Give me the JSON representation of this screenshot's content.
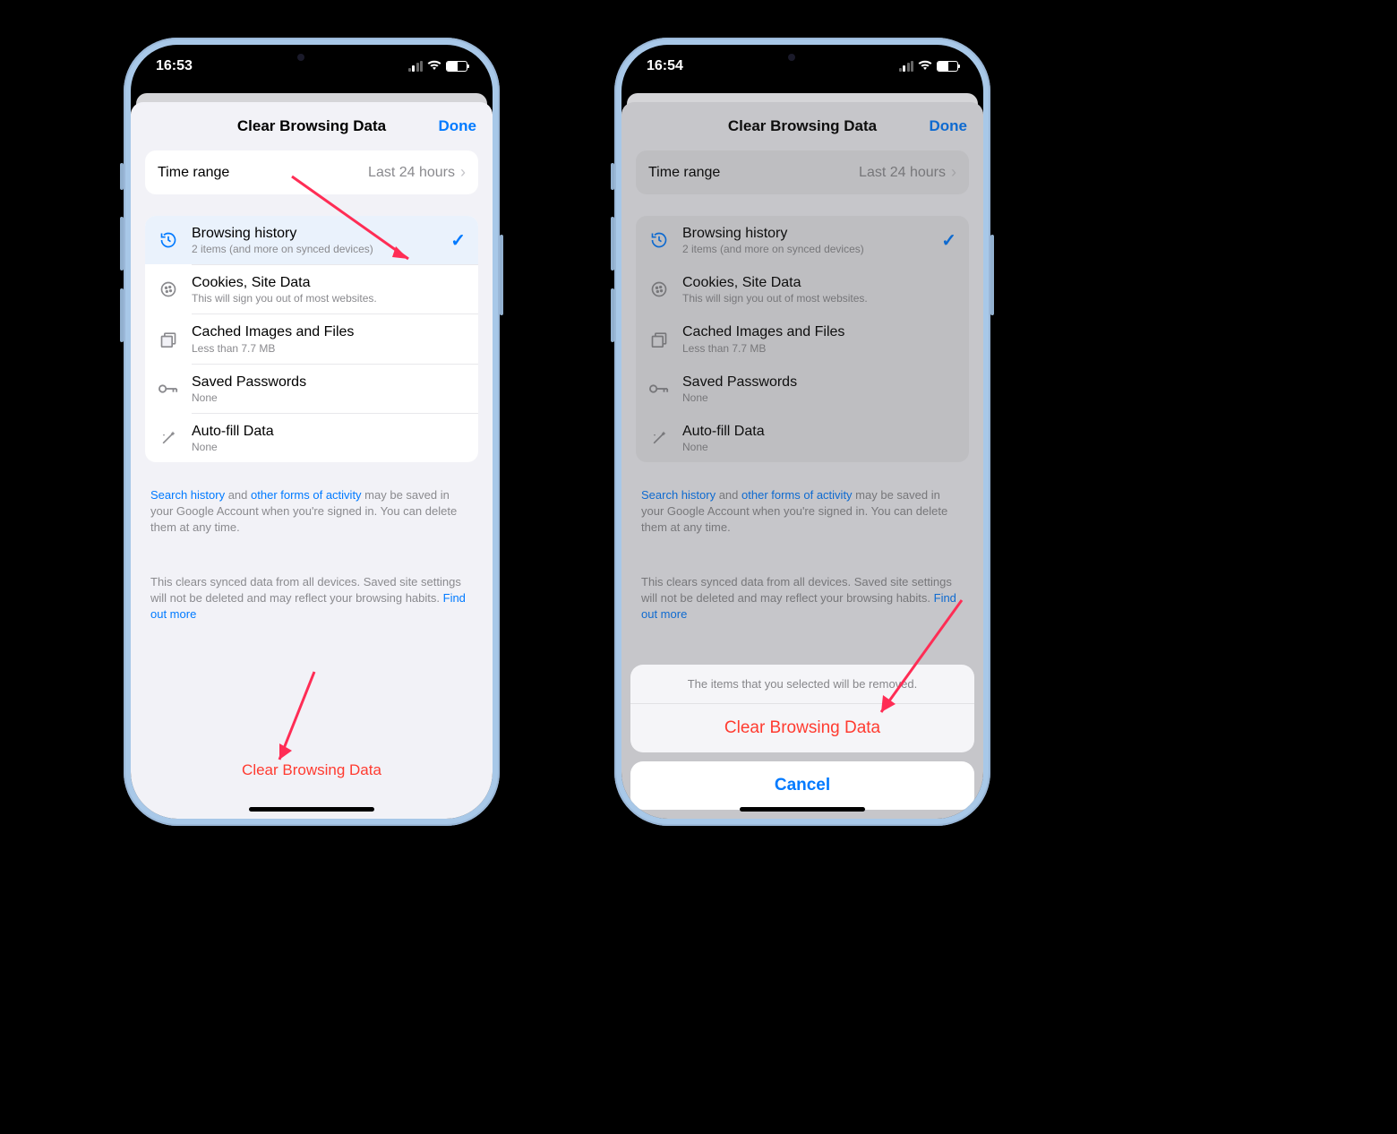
{
  "phone1": {
    "status_time": "16:53",
    "header": {
      "title": "Clear Browsing Data",
      "done": "Done"
    },
    "time_range": {
      "label": "Time range",
      "value": "Last 24 hours"
    },
    "items": [
      {
        "icon": "history-icon",
        "title": "Browsing history",
        "subtitle": "2 items (and more on synced devices)",
        "checked": true
      },
      {
        "icon": "cookie-icon",
        "title": "Cookies, Site Data",
        "subtitle": "This will sign you out of most websites.",
        "checked": false
      },
      {
        "icon": "image-icon",
        "title": "Cached Images and Files",
        "subtitle": "Less than 7.7 MB",
        "checked": false
      },
      {
        "icon": "key-icon",
        "title": "Saved Passwords",
        "subtitle": "None",
        "checked": false
      },
      {
        "icon": "wand-icon",
        "title": "Auto-fill Data",
        "subtitle": "None",
        "checked": false
      }
    ],
    "footer1": {
      "link1": "Search history",
      "mid1": " and ",
      "link2": "other forms of activity",
      "rest": " may be saved in your Google Account when you're signed in. You can delete them at any time."
    },
    "footer2": {
      "text": "This clears synced data from all devices. Saved site settings will not be deleted and may reflect your browsing habits. ",
      "link": "Find out more"
    },
    "clear_button": "Clear Browsing Data"
  },
  "phone2": {
    "status_time": "16:54",
    "header": {
      "title": "Clear Browsing Data",
      "done": "Done"
    },
    "time_range": {
      "label": "Time range",
      "value": "Last 24 hours"
    },
    "items": [
      {
        "icon": "history-icon",
        "title": "Browsing history",
        "subtitle": "2 items (and more on synced devices)",
        "checked": true
      },
      {
        "icon": "cookie-icon",
        "title": "Cookies, Site Data",
        "subtitle": "This will sign you out of most websites.",
        "checked": false
      },
      {
        "icon": "image-icon",
        "title": "Cached Images and Files",
        "subtitle": "Less than 7.7 MB",
        "checked": false
      },
      {
        "icon": "key-icon",
        "title": "Saved Passwords",
        "subtitle": "None",
        "checked": false
      },
      {
        "icon": "wand-icon",
        "title": "Auto-fill Data",
        "subtitle": "None",
        "checked": false
      }
    ],
    "footer1": {
      "link1": "Search history",
      "mid1": " and ",
      "link2": "other forms of activity",
      "rest": " may be saved in your Google Account when you're signed in. You can delete them at any time."
    },
    "footer2": {
      "text": "This clears synced data from all devices. Saved site settings will not be deleted and may reflect your browsing habits. ",
      "link": "Find out more"
    },
    "action_sheet": {
      "message": "The items that you selected will be removed.",
      "destructive": "Clear Browsing Data",
      "cancel": "Cancel"
    }
  },
  "icons": {
    "history-icon": "↺",
    "cookie-icon": "🍪",
    "image-icon": "▢",
    "key-icon": "⚿",
    "wand-icon": "✨"
  }
}
